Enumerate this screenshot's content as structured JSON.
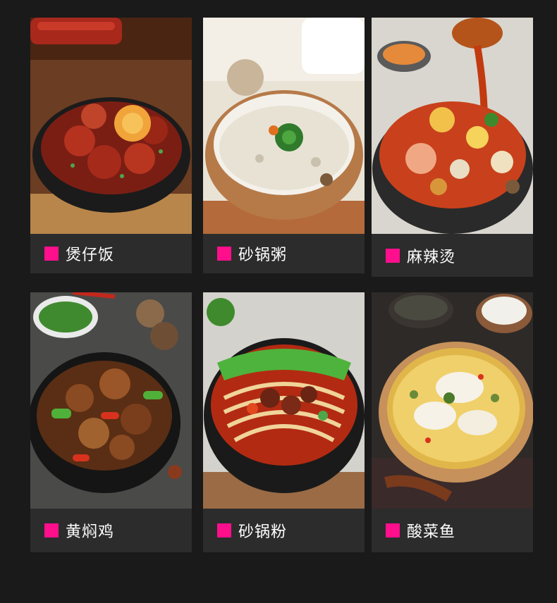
{
  "accent_color": "#ff0f8c",
  "background_color": "#1a1a1a",
  "dishes": [
    {
      "label": "煲仔饭",
      "image": "claypot-rice-photo"
    },
    {
      "label": "砂锅粥",
      "image": "claypot-congee-photo"
    },
    {
      "label": "麻辣烫",
      "image": "malatang-photo"
    },
    {
      "label": "黄焖鸡",
      "image": "braised-chicken-photo"
    },
    {
      "label": "砂锅粉",
      "image": "claypot-noodles-photo"
    },
    {
      "label": "酸菜鱼",
      "image": "pickled-fish-photo"
    }
  ]
}
